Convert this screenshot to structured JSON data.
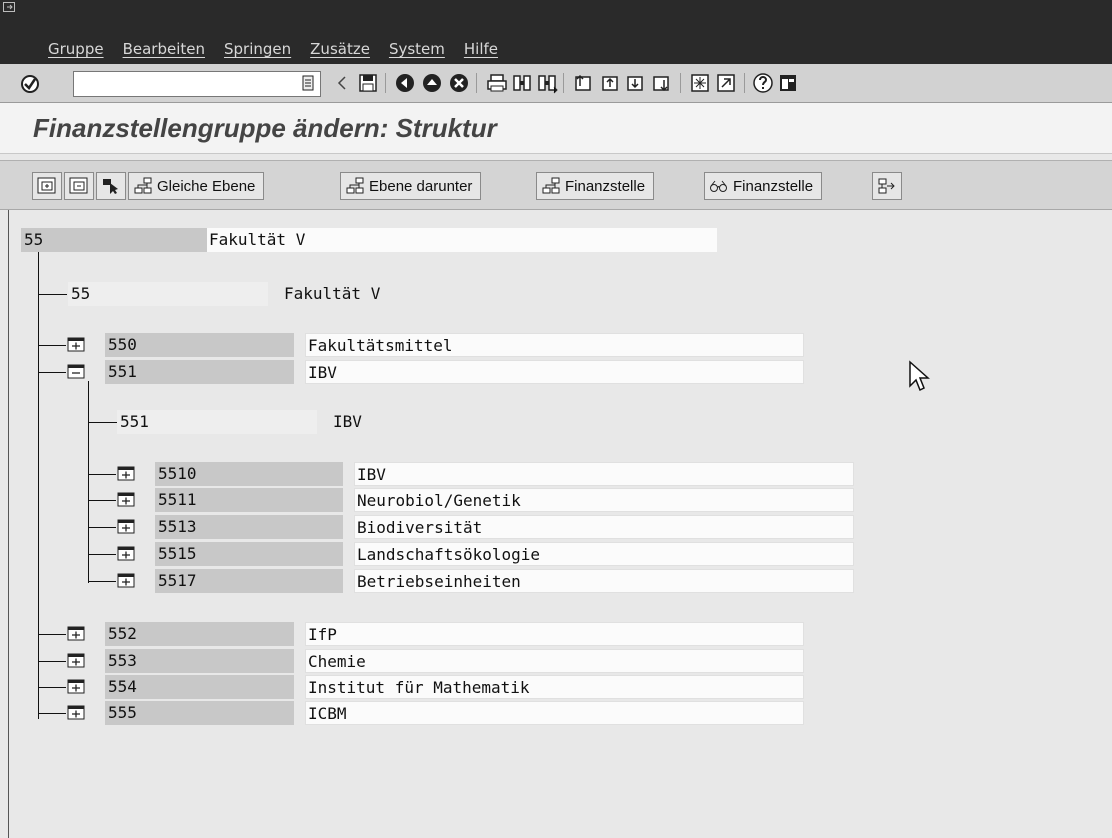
{
  "menu": [
    "Gruppe",
    "Bearbeiten",
    "Springen",
    "Zusätze",
    "System",
    "Hilfe"
  ],
  "command_field": {
    "value": ""
  },
  "screen_title": "Finanzstellengruppe ändern: Struktur",
  "app_toolbar": {
    "btn_same_level": "Gleiche Ebene",
    "btn_level_below": "Ebene darunter",
    "btn_fund_center_1": "Finanzstelle",
    "btn_fund_center_2": "Finanzstelle"
  },
  "tree": {
    "root": {
      "code": "55",
      "desc": "Fakultät V"
    },
    "l1_header": {
      "code": "55",
      "desc": "Fakultät V"
    },
    "l1_nodes": [
      {
        "code": "550",
        "desc": "Fakultätsmittel",
        "expanded": false
      },
      {
        "code": "551",
        "desc": "IBV",
        "expanded": true
      },
      {
        "code": "552",
        "desc": "IfP",
        "expanded": false
      },
      {
        "code": "553",
        "desc": "Chemie",
        "expanded": false
      },
      {
        "code": "554",
        "desc": "Institut für Mathematik",
        "expanded": false
      },
      {
        "code": "555",
        "desc": "ICBM",
        "expanded": false
      }
    ],
    "l2_header": {
      "code": "551",
      "desc": "IBV"
    },
    "l2_nodes": [
      {
        "code": "5510",
        "desc": "IBV"
      },
      {
        "code": "5511",
        "desc": "Neurobiol/Genetik"
      },
      {
        "code": "5513",
        "desc": "Biodiversität"
      },
      {
        "code": "5515",
        "desc": "Landschaftsökologie"
      },
      {
        "code": "5517",
        "desc": "Betriebseinheiten"
      }
    ]
  },
  "icons": {
    "enter": "checkmark-icon",
    "save": "save-icon",
    "back": "back-icon",
    "exit": "exit-icon",
    "cancel": "cancel-icon",
    "print": "print-icon",
    "find": "find-icon",
    "find_next": "find-next-icon",
    "help": "help-icon",
    "layout": "layout-icon"
  }
}
